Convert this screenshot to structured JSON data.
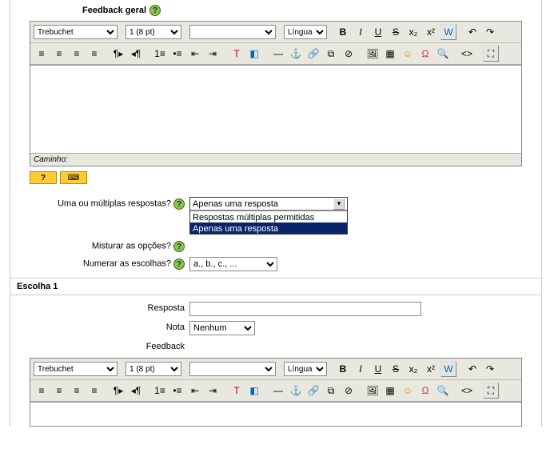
{
  "label_feedback_geral": "Feedback geral",
  "editor1": {
    "font": "Trebuchet",
    "size": "1 (8 pt)",
    "style": "",
    "lang": "Língua",
    "path_label": "Caminho:"
  },
  "form": {
    "q_respostas": {
      "label": "Uma ou múltiplas respostas?",
      "selected": "Apenas uma resposta",
      "options": [
        "Respostas múltiplas permitidas",
        "Apenas uma resposta"
      ],
      "highlight_index": 1
    },
    "q_misturar": {
      "label": "Misturar as opções?"
    },
    "q_numerar": {
      "label": "Numerar as escolhas?",
      "selected": "a., b., c., ..."
    }
  },
  "escolha1": {
    "heading": "Escolha 1",
    "resposta_label": "Resposta",
    "resposta_value": "",
    "nota_label": "Nota",
    "nota_value": "Nenhum",
    "feedback_label": "Feedback"
  },
  "editor2": {
    "font": "Trebuchet",
    "size": "1 (8 pt)",
    "style": "",
    "lang": "Língua"
  },
  "icons": {
    "bold": "B",
    "italic": "I",
    "underline": "U",
    "strike": "S",
    "sub": "x₂",
    "sup": "x²",
    "undo": "↶",
    "redo": "↷",
    "al": "≡",
    "ac": "≡",
    "ar": "≡",
    "aj": "≡",
    "ltr": "¶▸",
    "rtl": "◂¶",
    "ol": "1≡",
    "ul": "•≡",
    "outd": "⇤",
    "ind": "⇥",
    "fcolor": "T",
    "bcolor": "◧",
    "hr": "—",
    "anchor": "⚓",
    "link": "🔗",
    "unlink": "⧉",
    "nolink": "⊘",
    "img": "🖼",
    "tbl": "▦",
    "smile": "☺",
    "char": "Ω",
    "find": "🔍",
    "src": "<>",
    "full": "⛶"
  }
}
